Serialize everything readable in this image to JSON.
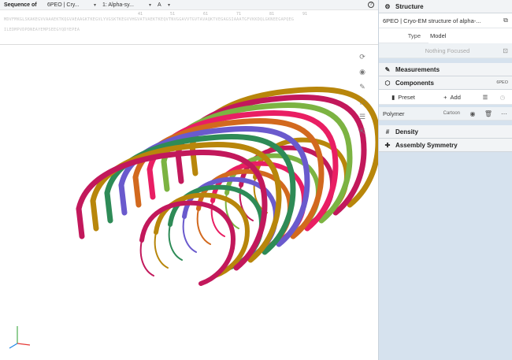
{
  "sequence": {
    "label": "Sequence of",
    "entry_select": "6PEO | Cry...",
    "chain_select": "1: Alpha-sy...",
    "asym_select": "A",
    "help_icon": "help-circle-icon",
    "numbers": [
      "41",
      "51",
      "61",
      "71",
      "81",
      "91"
    ],
    "line1": "MDVFMKGLSKAKEGVVAAAEKTKQGVAEAAGKTKEGVLYVGSKTKEGVVHGVATVAEKTKEQVTNVGGAVVTGVTAVAQKTVEGAGSIAAATGFVKKDQLGKNEEGAPQEG",
    "line2": "ILEDMPVDPDNEAYEMPSEEGYQDYEPEA"
  },
  "viewport": {
    "toolbar": [
      {
        "name": "reset-camera-icon",
        "glyph": "⟳"
      },
      {
        "name": "screenshot-icon",
        "glyph": "◉"
      },
      {
        "name": "controls-icon",
        "glyph": "✎"
      },
      {
        "name": "fullscreen-icon",
        "glyph": "⛶"
      },
      {
        "name": "settings-icon",
        "glyph": "☰"
      },
      {
        "name": "selection-mode-icon",
        "glyph": "⇱"
      }
    ],
    "structure_colors": [
      "#c2185b",
      "#b8860b",
      "#2e8b57",
      "#6a5acd",
      "#d2691e",
      "#e91e63",
      "#7cb342"
    ]
  },
  "panel": {
    "structure": {
      "title": "Structure",
      "entry": "6PEO | Cryo-EM structure of alpha-...",
      "type_label": "Type",
      "type_value": "Model",
      "nothing_focused": "Nothing Focused"
    },
    "measurements": {
      "title": "Measurements"
    },
    "components": {
      "title": "Components",
      "tag": "6PEO",
      "preset": "Preset",
      "add": "Add",
      "polymer": "Polymer",
      "polymer_repr": "Cartoon"
    },
    "density": {
      "title": "Density"
    },
    "assembly": {
      "title": "Assembly Symmetry"
    }
  }
}
